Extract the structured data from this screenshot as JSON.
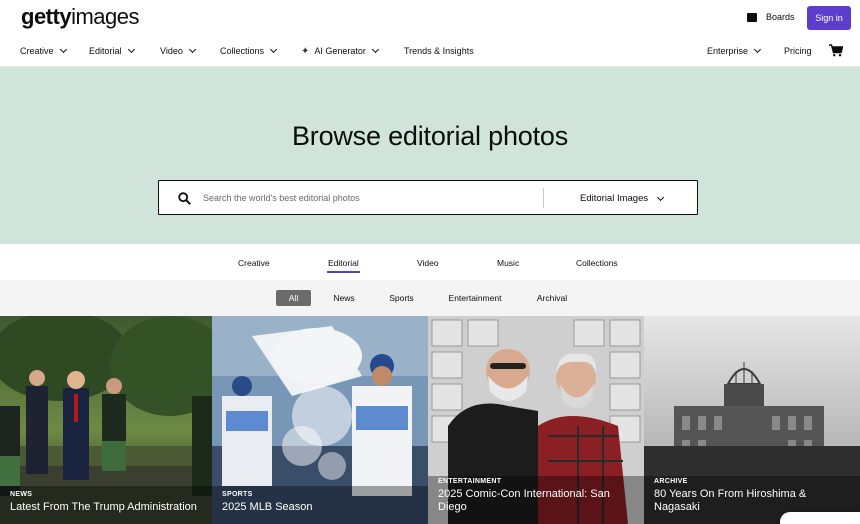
{
  "brand": {
    "bold": "getty",
    "regular": "images"
  },
  "header": {
    "boards_label": "Boards",
    "signin_label": "Sign in"
  },
  "nav": {
    "items": [
      "Creative",
      "Editorial",
      "Video",
      "Collections",
      "AI Generator",
      "Trends & Insights"
    ],
    "right": [
      "Enterprise",
      "Pricing"
    ]
  },
  "hero": {
    "title": "Browse editorial photos",
    "search_placeholder": "Search the world's best editorial photos",
    "search_type": "Editorial Images"
  },
  "tabs": {
    "items": [
      "Creative",
      "Editorial",
      "Video",
      "Music",
      "Collections"
    ],
    "active": "Editorial"
  },
  "filters": {
    "items": [
      "All",
      "News",
      "Sports",
      "Entertainment",
      "Archival"
    ],
    "active": "All"
  },
  "tiles": [
    {
      "category": "NEWS",
      "title": "Latest From The Trump Administration"
    },
    {
      "category": "SPORTS",
      "title": "2025 MLB Season"
    },
    {
      "category": "ENTERTAINMENT",
      "title": "2025 Comic-Con International: San Diego"
    },
    {
      "category": "ARCHIVE",
      "title": "80 Years On From Hiroshima & Nagasaki"
    }
  ],
  "colors": {
    "accent": "#5d3dcc",
    "hero_bg": "#d1e4db"
  }
}
